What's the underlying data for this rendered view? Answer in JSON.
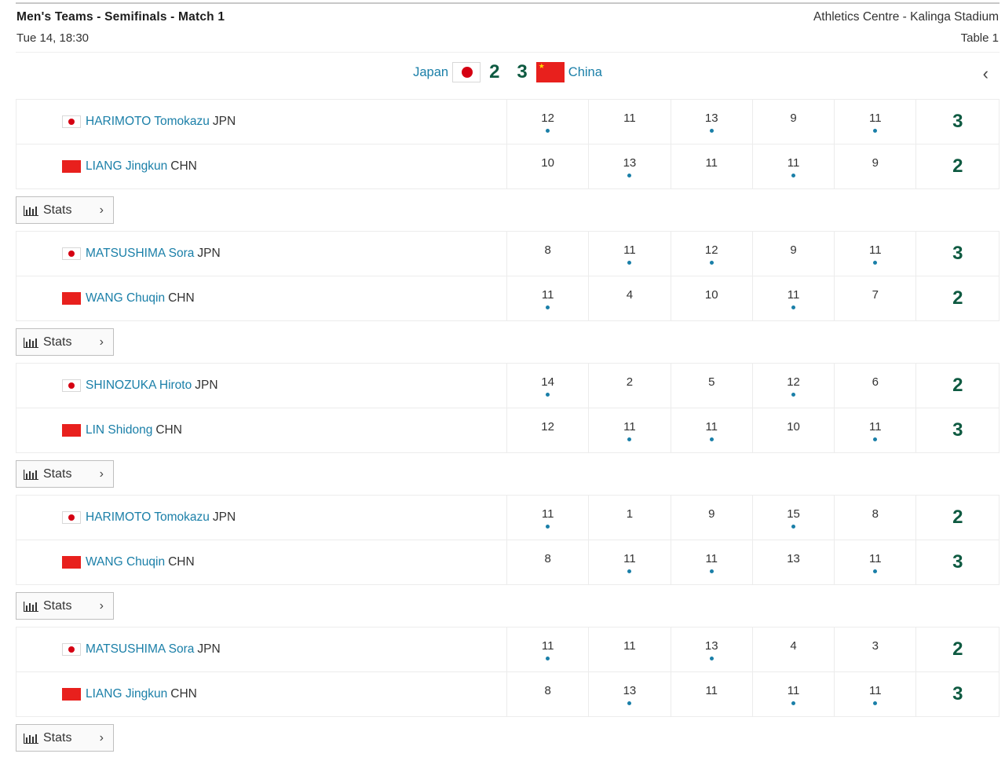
{
  "header": {
    "title": "Men's Teams - Semifinals - Match 1",
    "datetime": "Tue 14, 18:30",
    "venue": "Athletics Centre - Kalinga Stadium",
    "table": "Table 1"
  },
  "scoreline": {
    "home": {
      "name": "Japan",
      "score": "2",
      "flag": "japan-flag"
    },
    "away": {
      "name": "China",
      "score": "3",
      "flag": "china-flag"
    },
    "collapse_icon": "chevron-left-icon"
  },
  "stats_label": "Stats",
  "colors": {
    "link": "#1a7fa8",
    "score": "#0e5a41",
    "dot": "#1a7fa8"
  },
  "matches": [
    {
      "players": [
        {
          "name": "HARIMOTO Tomokazu",
          "code": "JPN",
          "flag": "jp",
          "games": [
            "12",
            "11",
            "13",
            "9",
            "11"
          ],
          "won": [
            1,
            0,
            1,
            0,
            1
          ],
          "total": "3"
        },
        {
          "name": "LIANG Jingkun",
          "code": "CHN",
          "flag": "cn",
          "games": [
            "10",
            "13",
            "11",
            "11",
            "9"
          ],
          "won": [
            0,
            1,
            0,
            1,
            0
          ],
          "total": "2"
        }
      ]
    },
    {
      "players": [
        {
          "name": "MATSUSHIMA Sora",
          "code": "JPN",
          "flag": "jp",
          "games": [
            "8",
            "11",
            "12",
            "9",
            "11"
          ],
          "won": [
            0,
            1,
            1,
            0,
            1
          ],
          "total": "3"
        },
        {
          "name": "WANG Chuqin",
          "code": "CHN",
          "flag": "cn",
          "games": [
            "11",
            "4",
            "10",
            "11",
            "7"
          ],
          "won": [
            1,
            0,
            0,
            1,
            0
          ],
          "total": "2"
        }
      ]
    },
    {
      "players": [
        {
          "name": "SHINOZUKA Hiroto",
          "code": "JPN",
          "flag": "jp",
          "games": [
            "14",
            "2",
            "5",
            "12",
            "6"
          ],
          "won": [
            1,
            0,
            0,
            1,
            0
          ],
          "total": "2"
        },
        {
          "name": "LIN Shidong",
          "code": "CHN",
          "flag": "cn",
          "games": [
            "12",
            "11",
            "11",
            "10",
            "11"
          ],
          "won": [
            0,
            1,
            1,
            0,
            1
          ],
          "total": "3"
        }
      ]
    },
    {
      "players": [
        {
          "name": "HARIMOTO Tomokazu",
          "code": "JPN",
          "flag": "jp",
          "games": [
            "11",
            "1",
            "9",
            "15",
            "8"
          ],
          "won": [
            1,
            0,
            0,
            1,
            0
          ],
          "total": "2"
        },
        {
          "name": "WANG Chuqin",
          "code": "CHN",
          "flag": "cn",
          "games": [
            "8",
            "11",
            "11",
            "13",
            "11"
          ],
          "won": [
            0,
            1,
            1,
            0,
            1
          ],
          "total": "3"
        }
      ]
    },
    {
      "players": [
        {
          "name": "MATSUSHIMA Sora",
          "code": "JPN",
          "flag": "jp",
          "games": [
            "11",
            "11",
            "13",
            "4",
            "3"
          ],
          "won": [
            1,
            0,
            1,
            0,
            0
          ],
          "total": "2"
        },
        {
          "name": "LIANG Jingkun",
          "code": "CHN",
          "flag": "cn",
          "games": [
            "8",
            "13",
            "11",
            "11",
            "11"
          ],
          "won": [
            0,
            1,
            0,
            1,
            1
          ],
          "total": "3"
        }
      ]
    }
  ]
}
